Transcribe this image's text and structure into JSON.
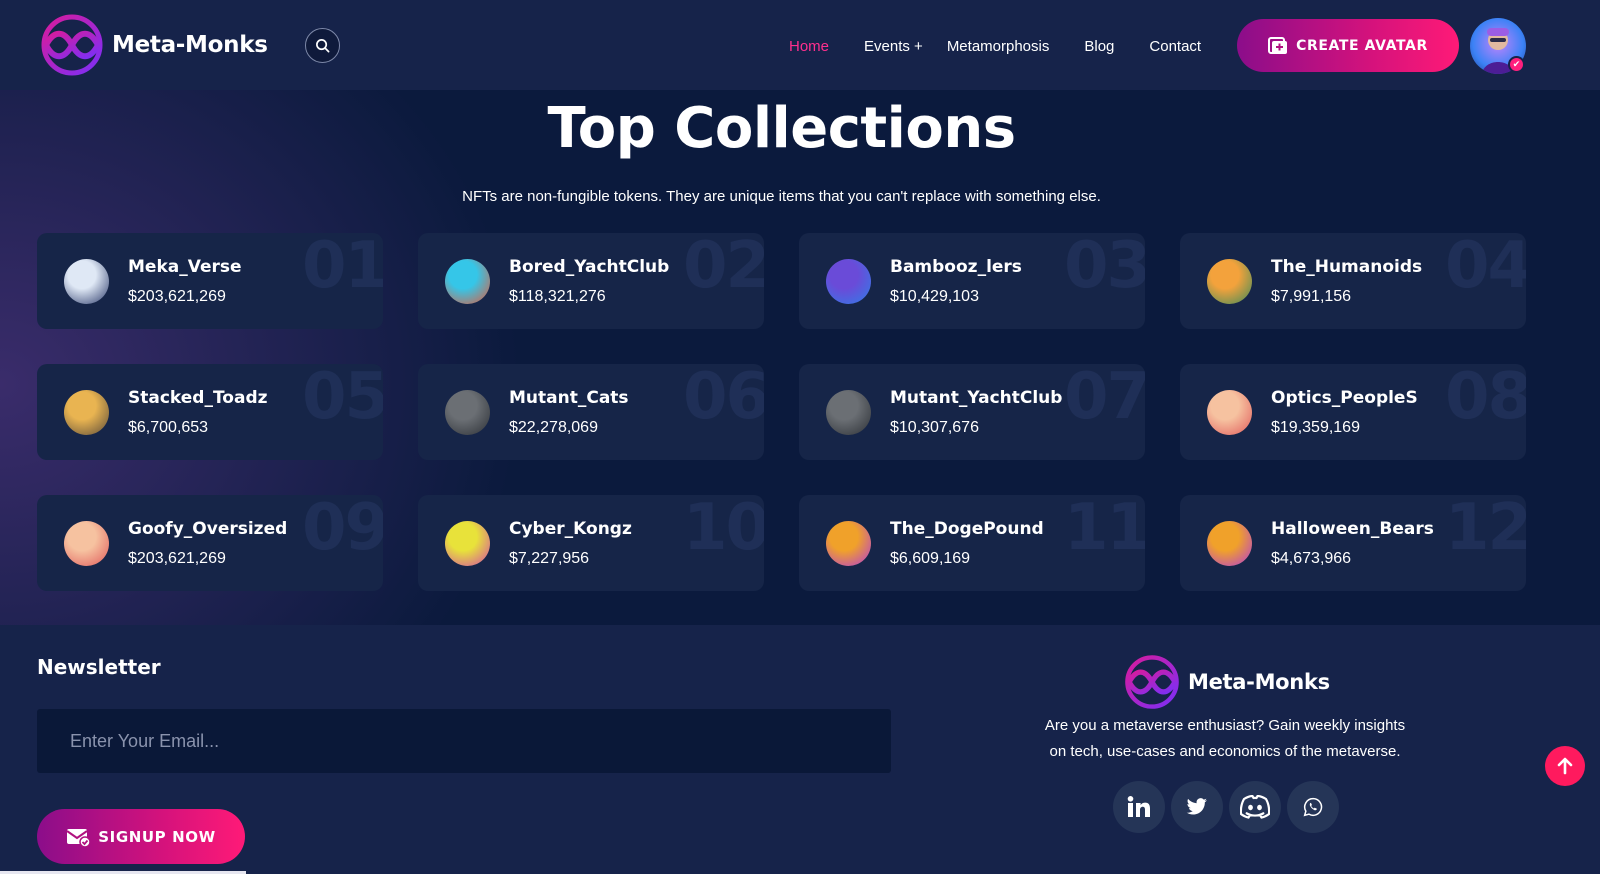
{
  "brand": {
    "name": "Meta-Monks"
  },
  "nav": {
    "items": [
      {
        "label": "Home",
        "active": true
      },
      {
        "label": "Events +",
        "active": false
      },
      {
        "label": "Metamorphosis",
        "active": false
      },
      {
        "label": "Blog",
        "active": false
      },
      {
        "label": "Contact",
        "active": false
      }
    ]
  },
  "header": {
    "create_avatar_label": "CREATE AVATAR"
  },
  "collections": {
    "title": "Top Collections",
    "subtitle": "NFTs are non-fungible tokens. They are unique items that you can't replace with something else.",
    "items": [
      {
        "num": "01",
        "name": "Meka_Verse",
        "value": "$203,621,269",
        "avatar_colors": [
          "#dfe8f5",
          "#2b3a6a"
        ]
      },
      {
        "num": "02",
        "name": "Bored_YachtClub",
        "value": "$118,321,276",
        "avatar_colors": [
          "#35c6e8",
          "#e2583a"
        ]
      },
      {
        "num": "03",
        "name": "Bambooz_lers",
        "value": "$10,429,103",
        "avatar_colors": [
          "#6a4bd8",
          "#2f7ee8"
        ]
      },
      {
        "num": "04",
        "name": "The_Humanoids",
        "value": "$7,991,156",
        "avatar_colors": [
          "#f3a23c",
          "#3a8a5a"
        ]
      },
      {
        "num": "05",
        "name": "Stacked_Toadz",
        "value": "$6,700,653",
        "avatar_colors": [
          "#e9b451",
          "#5a4a3a"
        ]
      },
      {
        "num": "06",
        "name": "Mutant_Cats",
        "value": "$22,278,069",
        "avatar_colors": [
          "#6b6f74",
          "#2c3036"
        ]
      },
      {
        "num": "07",
        "name": "Mutant_YachtClub",
        "value": "$10,307,676",
        "avatar_colors": [
          "#6b6f74",
          "#2c3036"
        ]
      },
      {
        "num": "08",
        "name": "Optics_PeopleS",
        "value": "$19,359,169",
        "avatar_colors": [
          "#f6c2a0",
          "#e05a5a"
        ]
      },
      {
        "num": "09",
        "name": "Goofy_Oversized",
        "value": "$203,621,269",
        "avatar_colors": [
          "#f6c2a0",
          "#e05a5a"
        ]
      },
      {
        "num": "10",
        "name": "Cyber_Kongz",
        "value": "$7,227,956",
        "avatar_colors": [
          "#e8e23a",
          "#d24aa8"
        ]
      },
      {
        "num": "11",
        "name": "The_DogePound",
        "value": "$6,609,169",
        "avatar_colors": [
          "#f0a12a",
          "#b23ad8"
        ]
      },
      {
        "num": "12",
        "name": "Halloween_Bears",
        "value": "$4,673,966",
        "avatar_colors": [
          "#f0a12a",
          "#b23ad8"
        ]
      }
    ]
  },
  "newsletter": {
    "title": "Newsletter",
    "email_placeholder": "Enter Your Email...",
    "signup_label": "SIGNUP NOW"
  },
  "footer": {
    "description_line1": "Are you a metaverse enthusiast? Gain weekly insights",
    "description_line2": "on tech, use-cases and economics of the metaverse.",
    "social": [
      "linkedin-icon",
      "twitter-icon",
      "discord-icon",
      "whatsapp-icon"
    ]
  },
  "colors": {
    "accent": "#ff1a77",
    "brand_purple": "#8b0d8a",
    "bg": "#0b1a3d",
    "header_bg": "#16234a",
    "card_bg": "#162548"
  }
}
